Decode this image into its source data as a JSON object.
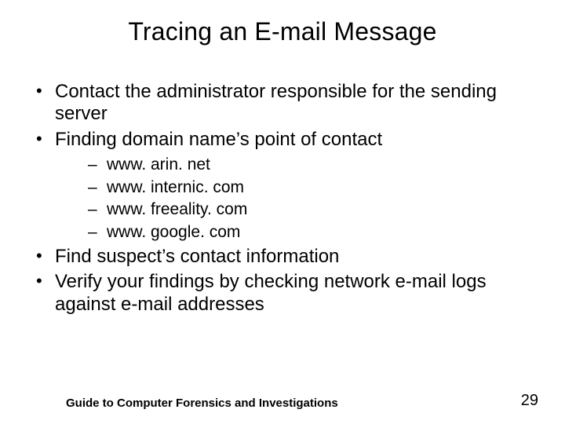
{
  "title": "Tracing an E-mail Message",
  "bullets": {
    "b1": "Contact the administrator responsible for the sending server",
    "b2": "Finding domain name’s point of contact",
    "sub": {
      "s1": "www. arin. net",
      "s2": "www. internic. com",
      "s3": "www. freeality. com",
      "s4": "www. google. com"
    },
    "b3": "Find suspect’s contact information",
    "b4": "Verify your findings by checking network e-mail logs against e-mail addresses"
  },
  "footer": "Guide to Computer Forensics and Investigations",
  "page": "29"
}
